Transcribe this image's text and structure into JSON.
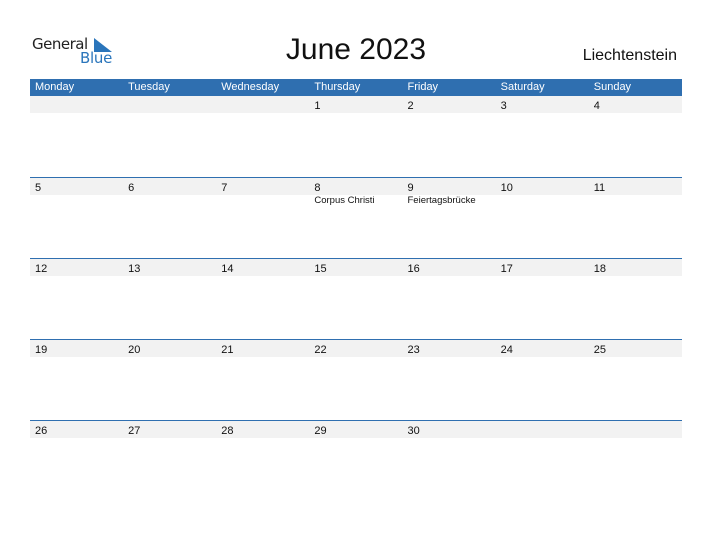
{
  "logo": {
    "line1": "General",
    "line2": "Blue"
  },
  "title": "June 2023",
  "country": "Liechtenstein",
  "colors": {
    "header_bg": "#2f6fb0",
    "logo_blue": "#2a75bb",
    "date_strip": "#f2f2f2"
  },
  "weekdays": [
    "Monday",
    "Tuesday",
    "Wednesday",
    "Thursday",
    "Friday",
    "Saturday",
    "Sunday"
  ],
  "weeks": [
    {
      "days": [
        {
          "d": "",
          "e": ""
        },
        {
          "d": "",
          "e": ""
        },
        {
          "d": "",
          "e": ""
        },
        {
          "d": "1",
          "e": ""
        },
        {
          "d": "2",
          "e": ""
        },
        {
          "d": "3",
          "e": ""
        },
        {
          "d": "4",
          "e": ""
        }
      ]
    },
    {
      "days": [
        {
          "d": "5",
          "e": ""
        },
        {
          "d": "6",
          "e": ""
        },
        {
          "d": "7",
          "e": ""
        },
        {
          "d": "8",
          "e": "Corpus Christi"
        },
        {
          "d": "9",
          "e": "Feiertagsbrücke"
        },
        {
          "d": "10",
          "e": ""
        },
        {
          "d": "11",
          "e": ""
        }
      ]
    },
    {
      "days": [
        {
          "d": "12",
          "e": ""
        },
        {
          "d": "13",
          "e": ""
        },
        {
          "d": "14",
          "e": ""
        },
        {
          "d": "15",
          "e": ""
        },
        {
          "d": "16",
          "e": ""
        },
        {
          "d": "17",
          "e": ""
        },
        {
          "d": "18",
          "e": ""
        }
      ]
    },
    {
      "days": [
        {
          "d": "19",
          "e": ""
        },
        {
          "d": "20",
          "e": ""
        },
        {
          "d": "21",
          "e": ""
        },
        {
          "d": "22",
          "e": ""
        },
        {
          "d": "23",
          "e": ""
        },
        {
          "d": "24",
          "e": ""
        },
        {
          "d": "25",
          "e": ""
        }
      ]
    },
    {
      "days": [
        {
          "d": "26",
          "e": ""
        },
        {
          "d": "27",
          "e": ""
        },
        {
          "d": "28",
          "e": ""
        },
        {
          "d": "29",
          "e": ""
        },
        {
          "d": "30",
          "e": ""
        },
        {
          "d": "",
          "e": ""
        },
        {
          "d": "",
          "e": ""
        }
      ]
    }
  ]
}
